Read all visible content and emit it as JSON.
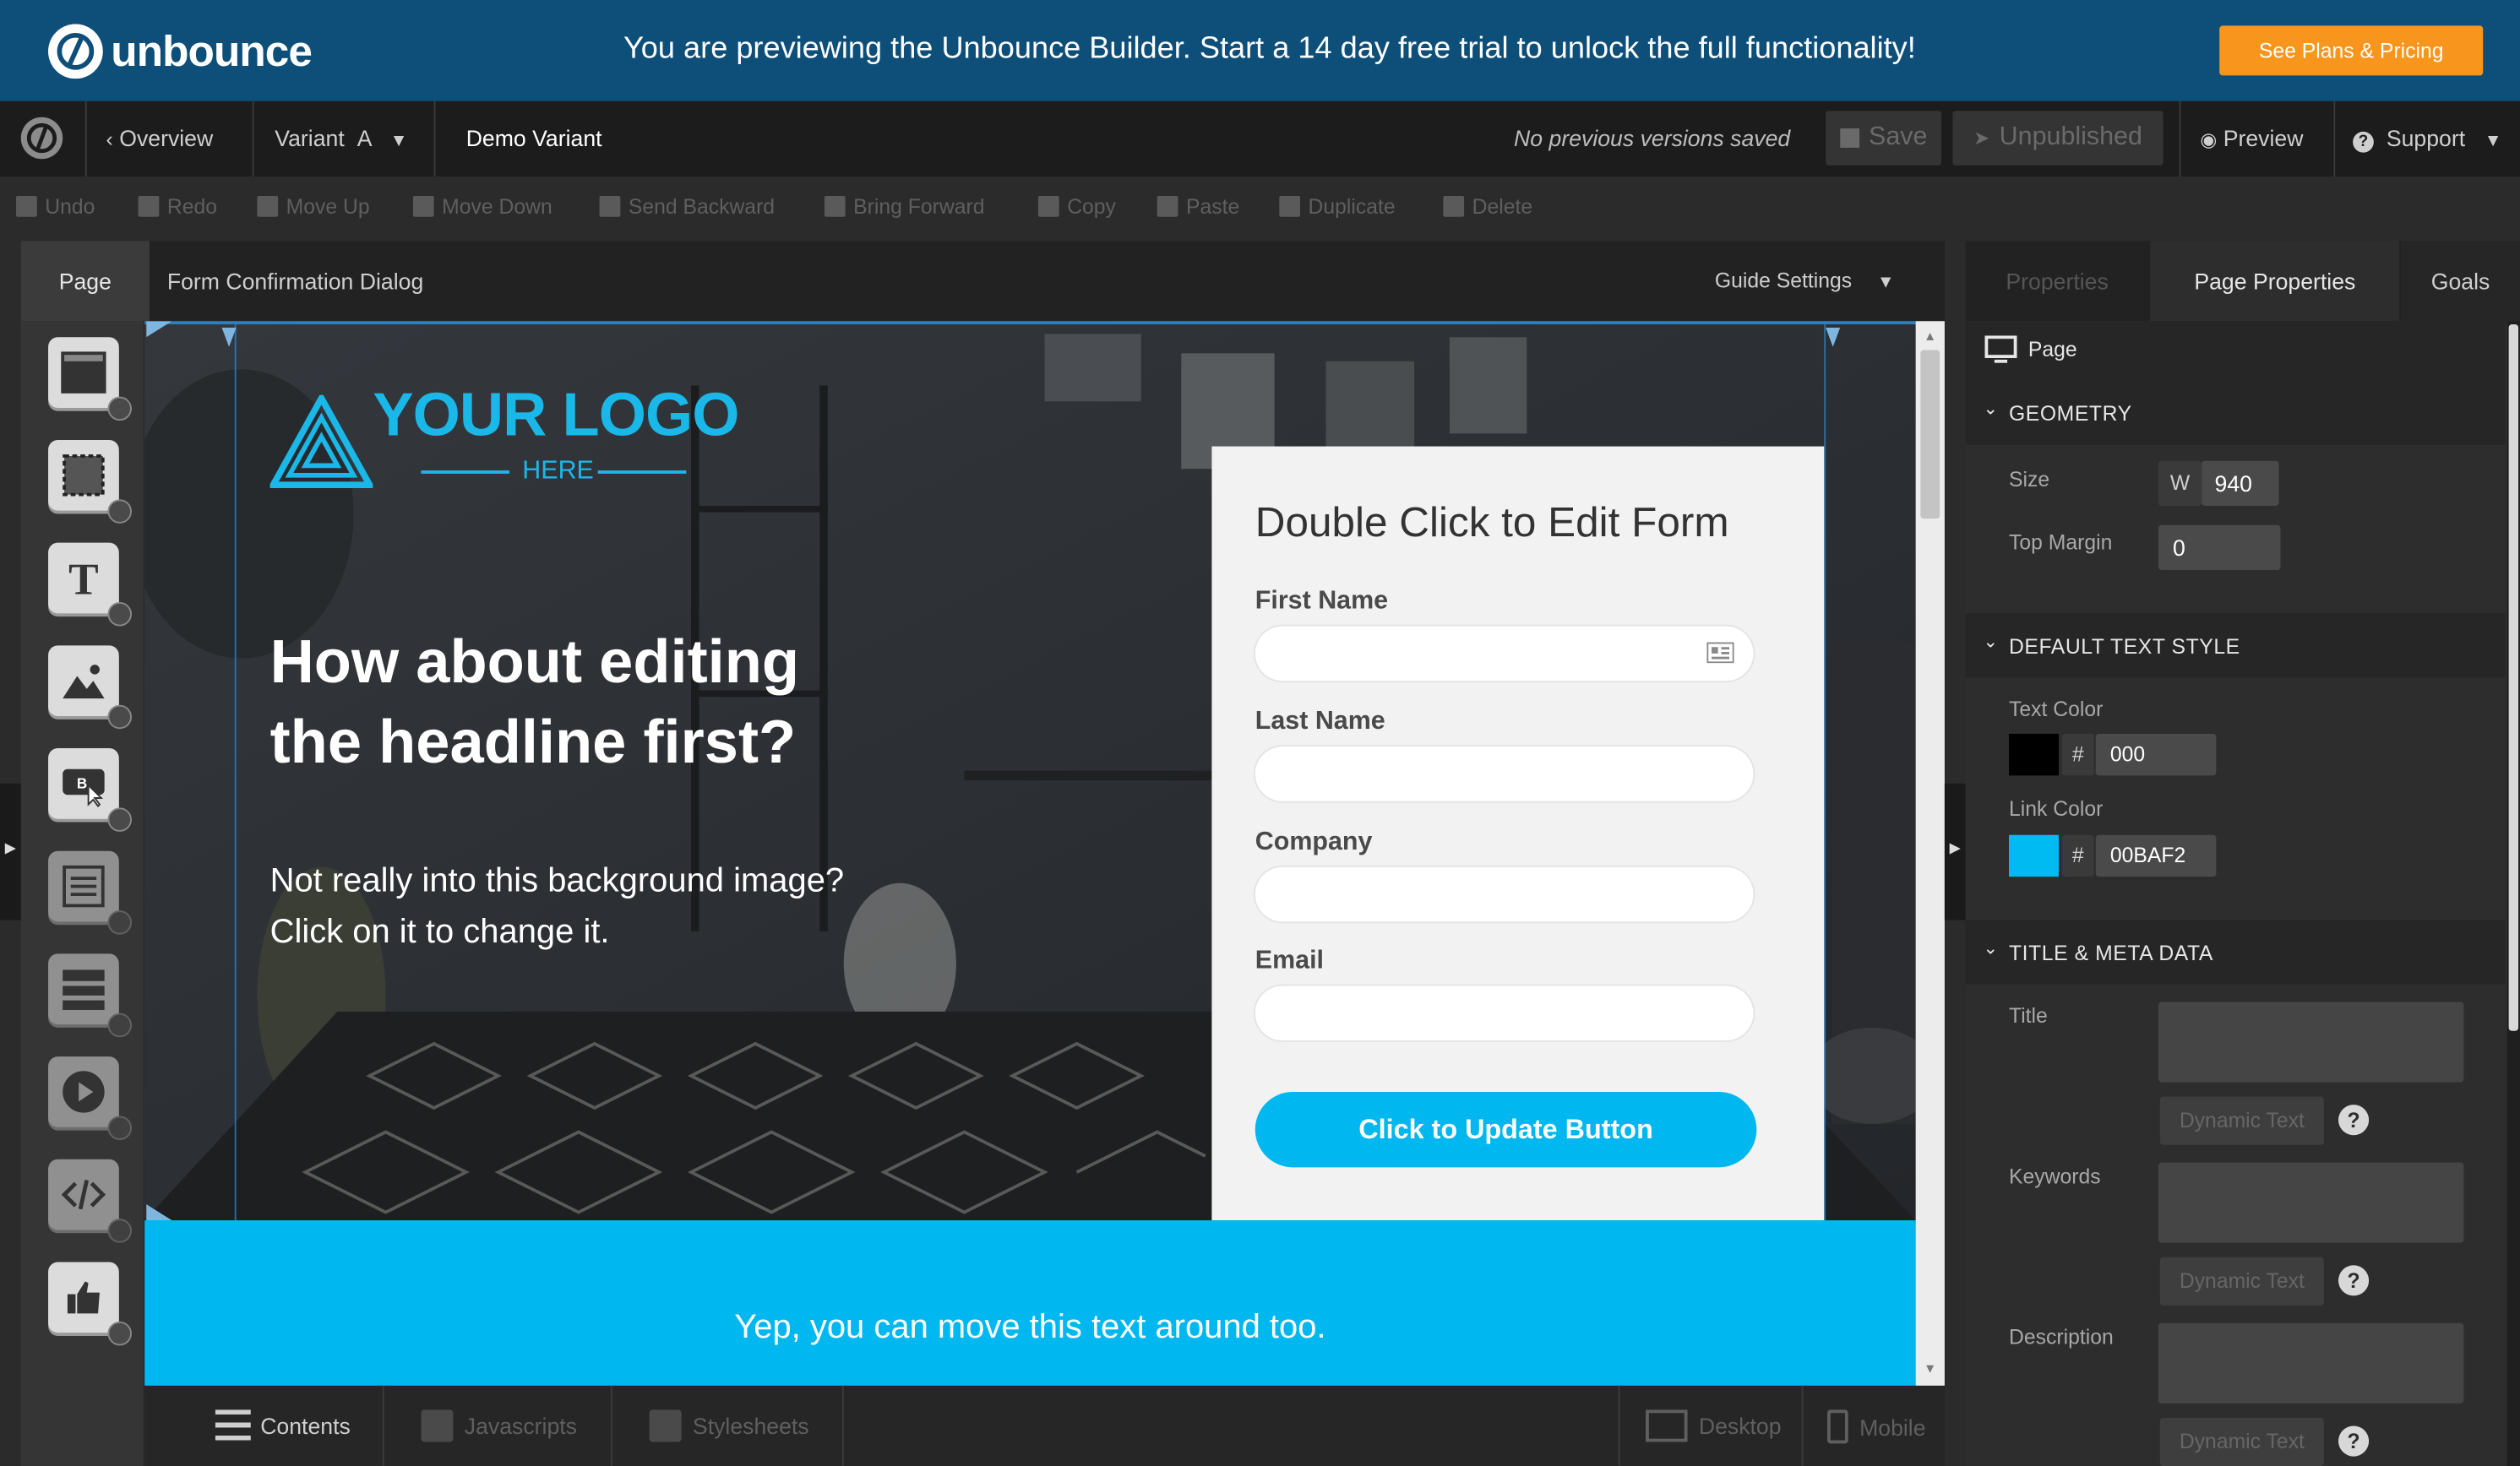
{
  "banner": {
    "logo_text": "unbounce",
    "message": "You are previewing the Unbounce Builder. Start a 14 day free trial to unlock the full functionality!",
    "cta": "See Plans & Pricing"
  },
  "toolbar": {
    "overview": "Overview",
    "variant": "Variant",
    "variant_letter": "A",
    "variant_name": "Demo Variant",
    "versions_status": "No previous versions saved",
    "save": "Save",
    "publish_state": "Unpublished",
    "preview": "Preview",
    "support": "Support"
  },
  "actions": {
    "undo": "Undo",
    "redo": "Redo",
    "move_up": "Move Up",
    "move_down": "Move Down",
    "send_backward": "Send Backward",
    "bring_forward": "Bring Forward",
    "copy": "Copy",
    "paste": "Paste",
    "duplicate": "Duplicate",
    "delete": "Delete"
  },
  "canvas_header": {
    "page_tab": "Page",
    "breadcrumb": "Form Confirmation Dialog",
    "guide_settings": "Guide Settings"
  },
  "tools": [
    "section-tool",
    "box-tool",
    "text-tool",
    "image-tool",
    "button-tool",
    "form-tool",
    "lightbox-tool",
    "video-tool",
    "custom-html-tool",
    "social-tool"
  ],
  "page": {
    "logo_main": "YOUR LOGO",
    "logo_sub": "HERE",
    "headline_line1": "How about editing",
    "headline_line2": "the headline first?",
    "subheadline": "Not really into this background image? Click on it to change it.",
    "strip_text": "Yep, you can move this text around too."
  },
  "form": {
    "title": "Double Click to Edit Form",
    "fields": [
      {
        "label": "First Name",
        "value": ""
      },
      {
        "label": "Last Name",
        "value": ""
      },
      {
        "label": "Company",
        "value": ""
      },
      {
        "label": "Email",
        "value": ""
      }
    ],
    "button": "Click to Update Button"
  },
  "bottom_bar": {
    "contents": "Contents",
    "javascripts": "Javascripts",
    "stylesheets": "Stylesheets",
    "desktop": "Desktop",
    "mobile": "Mobile"
  },
  "right_panel": {
    "tabs": [
      "Properties",
      "Page Properties",
      "Goals"
    ],
    "active_tab": "Page Properties",
    "object_label": "Page",
    "geometry": {
      "title": "GEOMETRY",
      "size_label": "Size",
      "size_prefix": "W",
      "size_value": "940",
      "top_margin_label": "Top Margin",
      "top_margin_value": "0"
    },
    "default_text_style": {
      "title": "DEFAULT TEXT STYLE",
      "text_color_label": "Text Color",
      "text_color_hex": "000",
      "text_color_swatch": "#000000",
      "link_color_label": "Link Color",
      "link_color_hex": "00BAF2",
      "link_color_swatch": "#00BAF2",
      "hash": "#"
    },
    "meta": {
      "title": "TITLE & META DATA",
      "title_label": "Title",
      "keywords_label": "Keywords",
      "description_label": "Description",
      "dynamic_text": "Dynamic Text",
      "help": "?"
    }
  },
  "colors": {
    "banner_bg": "#0E4F7A",
    "cta_orange": "#F8951D",
    "accent_blue": "#00B7F0"
  }
}
